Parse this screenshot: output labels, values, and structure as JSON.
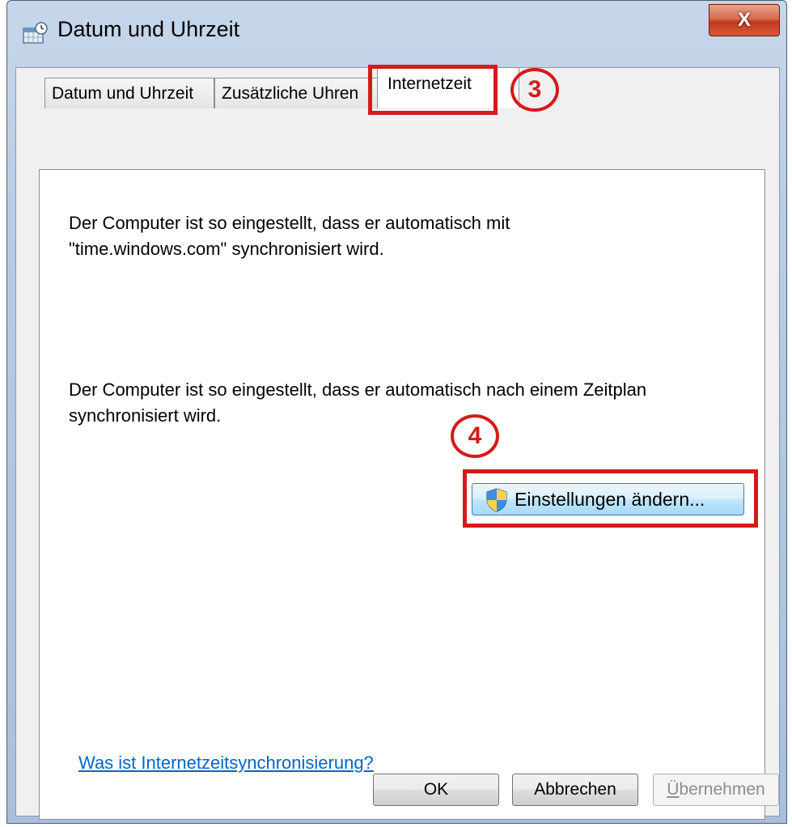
{
  "window": {
    "title": "Datum und Uhrzeit",
    "close_label": "X"
  },
  "tabs": [
    {
      "label": "Datum und Uhrzeit",
      "active": false
    },
    {
      "label": "Zusätzliche Uhren",
      "active": false
    },
    {
      "label": "Internetzeit",
      "active": true
    }
  ],
  "content": {
    "sync_server_text_line1": "Der Computer ist so eingestellt, dass er automatisch mit",
    "sync_server_text_line2": "\"time.windows.com\" synchronisiert wird.",
    "schedule_text_line1": "Der Computer ist so eingestellt, dass er automatisch nach einem Zeitplan",
    "schedule_text_line2": "synchronisiert wird.",
    "change_settings_label": "Einstellungen ändern...",
    "help_link": "Was ist Internetzeitsynchronisierung?"
  },
  "annotations": {
    "step_tab": "3",
    "step_button": "4",
    "color": "#d51a1a"
  },
  "buttons": {
    "ok": "OK",
    "cancel": "Abbrechen",
    "apply_prefix": "Ü",
    "apply_rest": "bernehmen"
  }
}
